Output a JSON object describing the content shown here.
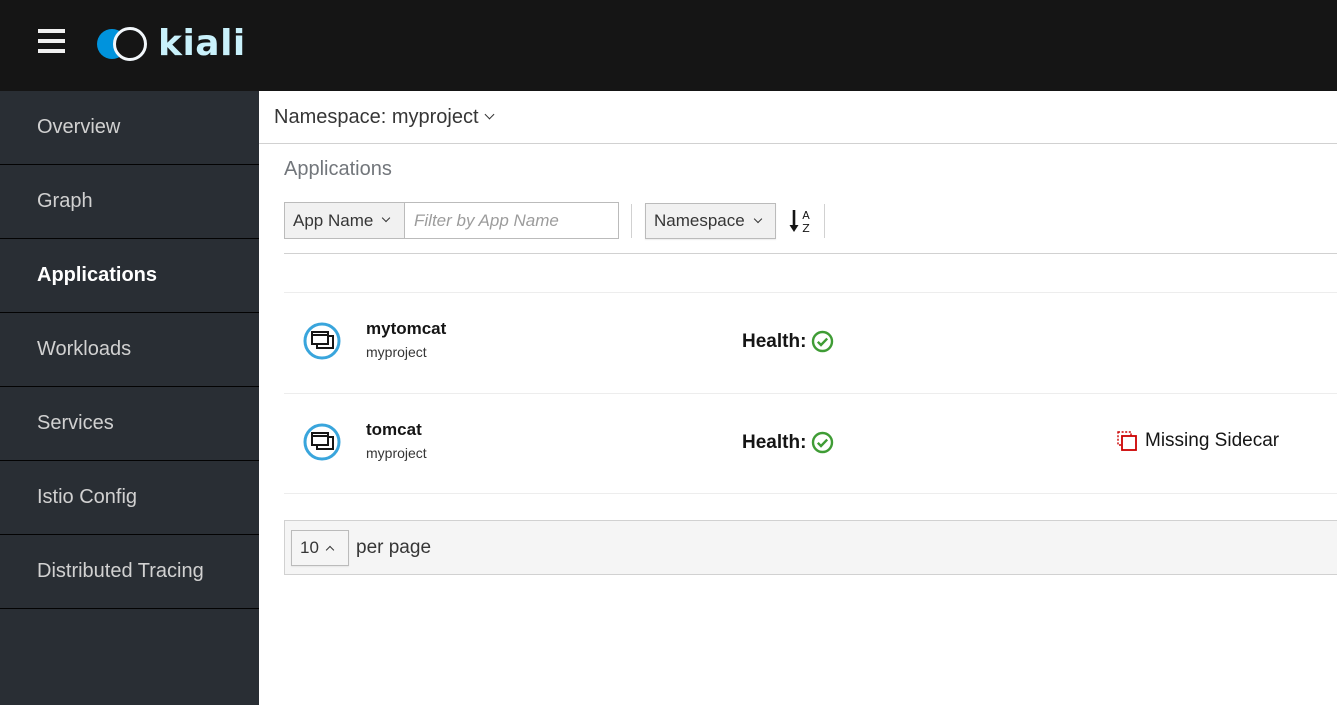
{
  "header": {
    "app_name": "kiali",
    "menu_icon": "hamburger-menu-icon",
    "logo_icon": "kiali-logo-icon"
  },
  "sidebar": {
    "items": [
      {
        "label": "Overview",
        "active": false
      },
      {
        "label": "Graph",
        "active": false
      },
      {
        "label": "Applications",
        "active": true
      },
      {
        "label": "Workloads",
        "active": false
      },
      {
        "label": "Services",
        "active": false
      },
      {
        "label": "Istio Config",
        "active": false
      },
      {
        "label": "Distributed Tracing",
        "active": false
      }
    ]
  },
  "namespace_bar": {
    "label": "Namespace: myproject"
  },
  "page": {
    "title": "Applications"
  },
  "toolbar": {
    "filter_type": "App Name",
    "filter_placeholder": "Filter by App Name",
    "filter_value": "",
    "sort_field": "Namespace",
    "sort_direction_icon": "sort-alpha-asc-icon"
  },
  "applications": [
    {
      "name": "mytomcat",
      "namespace": "myproject",
      "health_label": "Health:",
      "health_status": "healthy",
      "missing_sidecar": false,
      "sidecar_label": ""
    },
    {
      "name": "tomcat",
      "namespace": "myproject",
      "health_label": "Health:",
      "health_status": "healthy",
      "missing_sidecar": true,
      "sidecar_label": "Missing Sidecar"
    }
  ],
  "pagination": {
    "per_page_value": "10",
    "per_page_label": "per page"
  },
  "colors": {
    "topbar": "#151515",
    "sidebar": "#292e34",
    "logo_blue": "#0093dd",
    "logo_text": "#c9f1fb",
    "health_ok": "#3f9c35",
    "missing_sidecar": "#cc0000",
    "app_icon_ring": "#39a5dc"
  }
}
